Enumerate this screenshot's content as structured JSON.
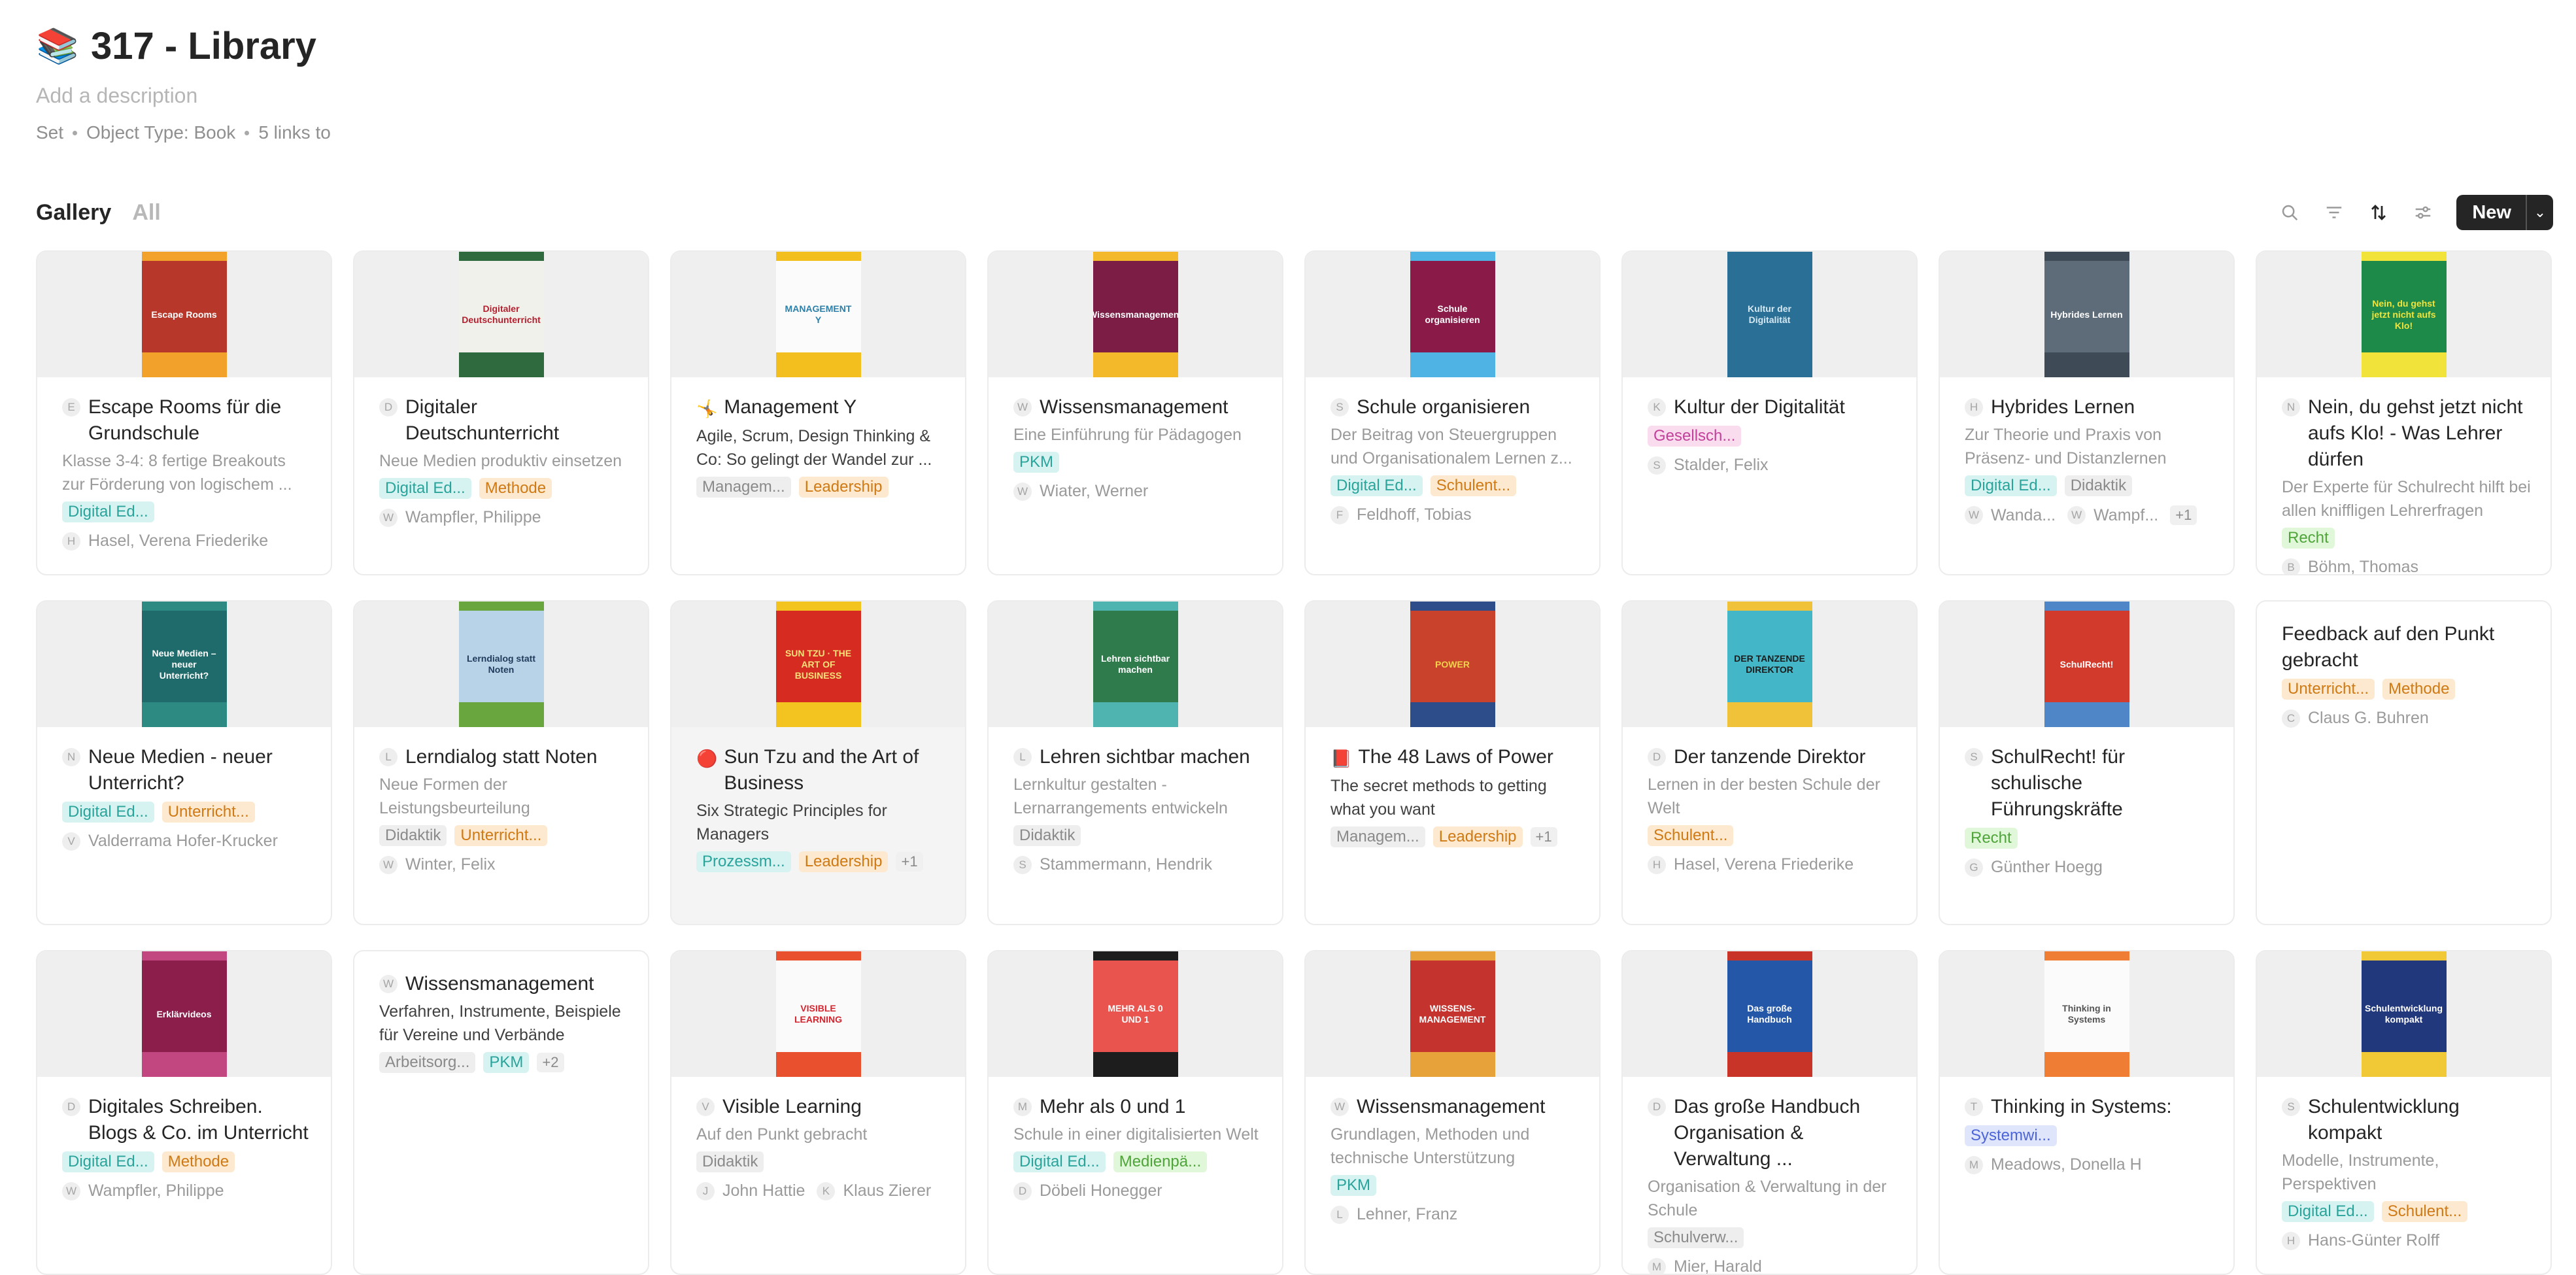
{
  "header": {
    "icon": "books-icon",
    "title": "317 - Library",
    "description_placeholder": "Add a description",
    "meta": [
      "Set",
      "Object Type: Book",
      "5 links to"
    ]
  },
  "view": {
    "tabs": [
      "Gallery",
      "All"
    ],
    "new_label": "New",
    "tools": [
      "search-icon",
      "filter-icon",
      "sort-icon",
      "settings-icon"
    ]
  },
  "tag_colors": {
    "Digital Ed...": [
      "#d6f3f1",
      "#2aa39b"
    ],
    "Methode": [
      "#fde9cf",
      "#cf7a14"
    ],
    "Managem...": [
      "#eeeeee",
      "#8a8a8a"
    ],
    "Leadership": [
      "#fde9cf",
      "#cf7a14"
    ],
    "PKM": [
      "#d6f3f1",
      "#2aa39b"
    ],
    "Schulent...": [
      "#fde9cf",
      "#cf7a14"
    ],
    "Gesellsch...": [
      "#fadcef",
      "#c2429a"
    ],
    "Didaktik": [
      "#eeeeee",
      "#8a8a8a"
    ],
    "Recht": [
      "#e1f7d9",
      "#4fa43a"
    ],
    "Unterricht...": [
      "#fde9cf",
      "#cf7a14"
    ],
    "Prozessm...": [
      "#d6f3f1",
      "#2aa39b"
    ],
    "Arbeitsorg...": [
      "#eeeeee",
      "#8a8a8a"
    ],
    "Medienpä...": [
      "#e1f7d9",
      "#4fa43a"
    ],
    "Schulverw...": [
      "#eeeeee",
      "#8a8a8a"
    ],
    "Systemwi...": [
      "#dfe6fc",
      "#4d64d8"
    ]
  },
  "cards": [
    {
      "letter": "E",
      "title": "Escape Rooms für die Grundschule",
      "subtitle": "Klasse 3-4: 8 fertige Breakouts zur Förderung von logischem ...",
      "tags": [
        "Digital Ed..."
      ],
      "authors": [
        {
          "l": "H",
          "n": "Hasel, Verena Friederike"
        }
      ],
      "cover": {
        "bg": "#b7382a",
        "stripe": "#f2a12b",
        "label": "Escape Rooms",
        "fg": "#ffffff"
      }
    },
    {
      "letter": "D",
      "title": "Digitaler Deutschunterricht",
      "subtitle": "Neue Medien produktiv einsetzen",
      "tags": [
        "Digital Ed...",
        "Methode"
      ],
      "authors": [
        {
          "l": "W",
          "n": "Wampfler, Philippe"
        }
      ],
      "cover": {
        "bg": "#f1f1ec",
        "stripe": "#2e6a3d",
        "label": "Digitaler Deutschunterricht",
        "fg": "#b21f2d"
      }
    },
    {
      "emoji": "🤸",
      "title": "Management Y",
      "subtitle": "Agile, Scrum, Design Thinking & Co: So gelingt der Wandel zur ...",
      "dark": true,
      "tags": [
        "Managem...",
        "Leadership"
      ],
      "authors": [],
      "cover": {
        "bg": "#fbfbfb",
        "stripe": "#f3bf1f",
        "label": "MANAGEMENT Y",
        "fg": "#2d7fa8"
      }
    },
    {
      "letter": "W",
      "title": "Wissensmanagement",
      "subtitle": "Eine Einführung für Pädagogen",
      "tags": [
        "PKM"
      ],
      "authors": [
        {
          "l": "W",
          "n": "Wiater, Werner"
        }
      ],
      "cover": {
        "bg": "#7b1d45",
        "stripe": "#f3b92a",
        "label": "Wissensmanagement",
        "fg": "#ffffff"
      }
    },
    {
      "letter": "S",
      "title": "Schule organisieren",
      "subtitle": "Der Beitrag von Steuergruppen und Organisationalem Lernen z...",
      "tags": [
        "Digital Ed...",
        "Schulent..."
      ],
      "authors": [
        {
          "l": "F",
          "n": "Feldhoff, Tobias"
        }
      ],
      "cover": {
        "bg": "#8a1b49",
        "stripe": "#4fb3e3",
        "label": "Schule organisieren",
        "fg": "#ffffff"
      }
    },
    {
      "letter": "K",
      "title": "Kultur der Digitalität",
      "subtitle": "",
      "tags": [
        "Gesellsch..."
      ],
      "authors": [
        {
          "l": "S",
          "n": "Stalder, Felix"
        }
      ],
      "cover": {
        "bg": "#2a6f96",
        "stripe": "#2a6f96",
        "label": "Kultur der Digitalität",
        "fg": "#d6e8f2"
      }
    },
    {
      "letter": "H",
      "title": "Hybrides Lernen",
      "subtitle": "Zur Theorie und Praxis von Präsenz- und Distanzlernen",
      "tags": [
        "Digital Ed...",
        "Didaktik"
      ],
      "authors": [
        {
          "l": "W",
          "n": "Wanda..."
        },
        {
          "l": "W",
          "n": "Wampf..."
        }
      ],
      "more": "+1",
      "cover": {
        "bg": "#5e6b78",
        "stripe": "#3f4a57",
        "label": "Hybrides Lernen",
        "fg": "#ffffff"
      }
    },
    {
      "letter": "N",
      "title": "Nein, du gehst jetzt nicht aufs Klo! - Was Lehrer dürfen",
      "subtitle": "Der Experte für Schulrecht hilft bei allen kniffligen Lehrerfragen",
      "tags": [
        "Recht"
      ],
      "authors": [
        {
          "l": "B",
          "n": "Böhm, Thomas"
        }
      ],
      "cover": {
        "bg": "#1e8a4a",
        "stripe": "#f2e33a",
        "label": "Nein, du gehst jetzt nicht aufs Klo!",
        "fg": "#f2e33a"
      }
    },
    {
      "letter": "N",
      "title": "Neue Medien - neuer Unterricht?",
      "subtitle": "",
      "tags": [
        "Digital Ed...",
        "Unterricht..."
      ],
      "authors": [
        {
          "l": "V",
          "n": "Valderrama Hofer-Krucker"
        }
      ],
      "cover": {
        "bg": "#1f6b6b",
        "stripe": "#2d8a83",
        "label": "Neue Medien – neuer Unterricht?",
        "fg": "#ffffff"
      }
    },
    {
      "letter": "L",
      "title": "Lerndialog statt Noten",
      "subtitle": "Neue Formen der Leistungsbeurteilung",
      "tags": [
        "Didaktik",
        "Unterricht..."
      ],
      "authors": [
        {
          "l": "W",
          "n": "Winter, Felix"
        }
      ],
      "cover": {
        "bg": "#b8d3e8",
        "stripe": "#6aa63e",
        "label": "Lerndialog statt Noten",
        "fg": "#1f3a5a"
      }
    },
    {
      "emoji": "🔴",
      "title": "Sun Tzu and the Art of Business",
      "subtitle": "Six Strategic Principles for Managers",
      "dark": true,
      "grey": true,
      "tags": [
        "Prozessm...",
        "Leadership"
      ],
      "more": "+1",
      "authors": [],
      "cover": {
        "bg": "#d62b21",
        "stripe": "#f3c31f",
        "label": "SUN TZU · THE ART OF BUSINESS",
        "fg": "#f7e27a"
      }
    },
    {
      "letter": "L",
      "title": "Lehren sichtbar machen",
      "subtitle": "Lernkultur gestalten - Lernarrangements entwickeln",
      "tags": [
        "Didaktik"
      ],
      "authors": [
        {
          "l": "S",
          "n": "Stammermann, Hendrik"
        }
      ],
      "cover": {
        "bg": "#2f7b4c",
        "stripe": "#4fb3b0",
        "label": "Lehren sichtbar machen",
        "fg": "#ffffff"
      }
    },
    {
      "emoji": "📕",
      "title": "The 48 Laws of Power",
      "subtitle": "The secret methods to getting what you want",
      "dark": true,
      "tags": [
        "Managem...",
        "Leadership"
      ],
      "more": "+1",
      "authors": [],
      "cover": {
        "bg": "#c8422c",
        "stripe": "#2c4d8a",
        "label": "POWER",
        "fg": "#f2d24b"
      }
    },
    {
      "letter": "D",
      "title": "Der tanzende Direktor",
      "subtitle": "Lernen in der besten Schule der Welt",
      "tags": [
        "Schulent..."
      ],
      "authors": [
        {
          "l": "H",
          "n": "Hasel, Verena Friederike"
        }
      ],
      "cover": {
        "bg": "#43b7c8",
        "stripe": "#f0c23a",
        "label": "DER TANZENDE DIREKTOR",
        "fg": "#1b1b1b"
      }
    },
    {
      "letter": "S",
      "title": "SchulRecht! für schulische Führungskräfte",
      "subtitle": "",
      "tags": [
        "Recht"
      ],
      "authors": [
        {
          "l": "G",
          "n": "Günther Hoegg"
        }
      ],
      "cover": {
        "bg": "#d23a2c",
        "stripe": "#4f86c8",
        "label": "SchulRecht!",
        "fg": "#ffffff"
      }
    },
    {
      "letter": "C",
      "title": "Feedback auf den Punkt gebracht",
      "subtitle": "",
      "tags": [
        "Unterricht...",
        "Methode"
      ],
      "authors": [
        {
          "l": "C",
          "n": "Claus G. Buhren"
        }
      ],
      "nocover": true
    },
    {
      "letter": "D",
      "title": "Digitales Schreiben. Blogs & Co. im Unterricht",
      "subtitle": "",
      "tags": [
        "Digital Ed...",
        "Methode"
      ],
      "authors": [
        {
          "l": "W",
          "n": "Wampfler, Philippe"
        }
      ],
      "cover": {
        "bg": "#8c1e4c",
        "stripe": "#c2467f",
        "label": "Erklärvideos",
        "fg": "#ffffff"
      }
    },
    {
      "letter": "W",
      "title": "Wissensmanagement",
      "subtitle": "Verfahren, Instrumente, Beispiele für Vereine und Verbände",
      "dark": true,
      "tags": [
        "Arbeitsorg...",
        "PKM"
      ],
      "more": "+2",
      "authors": [],
      "nocover": true,
      "titlefirst": true
    },
    {
      "letter": "V",
      "title": "Visible Learning",
      "subtitle": "Auf den Punkt gebracht",
      "tags": [
        "Didaktik"
      ],
      "authors": [
        {
          "l": "J",
          "n": "John Hattie"
        },
        {
          "l": "K",
          "n": "Klaus Zierer"
        }
      ],
      "cover": {
        "bg": "#fafafa",
        "stripe": "#e9502e",
        "label": "VISIBLE LEARNING",
        "fg": "#d2252f"
      }
    },
    {
      "letter": "M",
      "title": "Mehr als 0 und 1",
      "subtitle": "Schule in einer digitalisierten Welt",
      "tags": [
        "Digital Ed...",
        "Medienpä..."
      ],
      "authors": [
        {
          "l": "D",
          "n": "Döbeli Honegger"
        }
      ],
      "cover": {
        "bg": "#e9554e",
        "stripe": "#1d1d1d",
        "label": "MEHR ALS 0 UND 1",
        "fg": "#ffffff"
      }
    },
    {
      "letter": "W",
      "title": "Wissensmanagement",
      "subtitle": "Grundlagen, Methoden und technische Unterstützung",
      "tags": [
        "PKM"
      ],
      "authors": [
        {
          "l": "L",
          "n": "Lehner, Franz"
        }
      ],
      "cover": {
        "bg": "#c4332e",
        "stripe": "#e7a23a",
        "label": "WISSENS-MANAGEMENT",
        "fg": "#ffffff"
      }
    },
    {
      "letter": "D",
      "title": "Das große Handbuch Organisation & Verwaltung ...",
      "subtitle": "Organisation & Verwaltung in der Schule",
      "tags": [
        "Schulverw..."
      ],
      "authors": [
        {
          "l": "M",
          "n": "Mier, Harald"
        }
      ],
      "cover": {
        "bg": "#2457a8",
        "stripe": "#c93429",
        "label": "Das große Handbuch",
        "fg": "#ffffff"
      }
    },
    {
      "letter": "T",
      "title": "Thinking in Systems:",
      "subtitle": "",
      "tags": [
        "Systemwi..."
      ],
      "authors": [
        {
          "l": "M",
          "n": "Meadows, Donella H"
        }
      ],
      "cover": {
        "bg": "#fbfbfb",
        "stripe": "#ef7d34",
        "label": "Thinking in Systems",
        "fg": "#555555"
      }
    },
    {
      "letter": "S",
      "title": "Schulentwicklung kompakt",
      "subtitle": "Modelle, Instrumente, Perspektiven",
      "tags": [
        "Digital Ed...",
        "Schulent..."
      ],
      "authors": [
        {
          "l": "H",
          "n": "Hans-Günter Rolff"
        }
      ],
      "cover": {
        "bg": "#22387c",
        "stripe": "#f1c937",
        "label": "Schulentwicklung kompakt",
        "fg": "#ffffff"
      }
    }
  ]
}
